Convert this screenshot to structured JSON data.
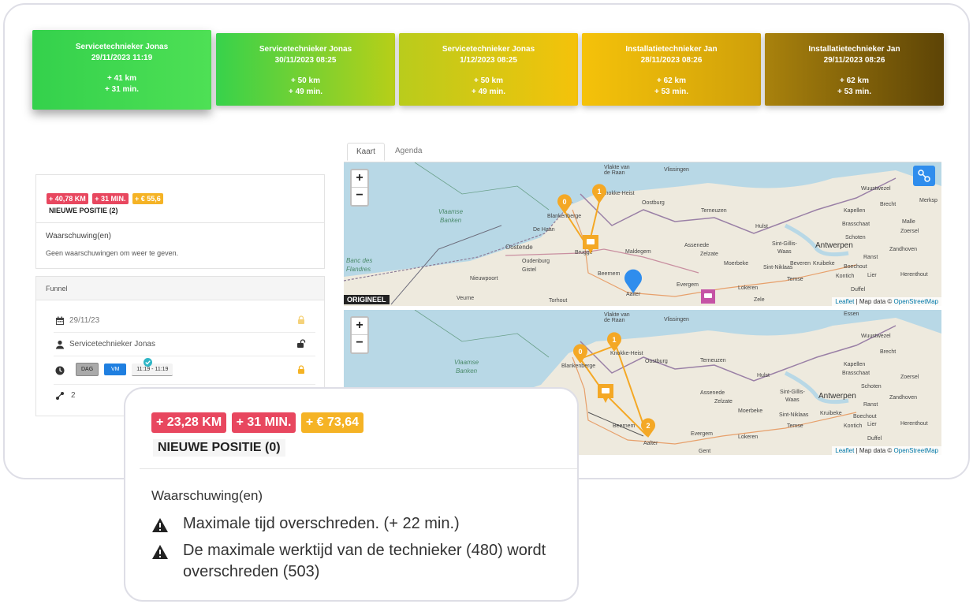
{
  "cards": [
    {
      "title": "Servicetechnieker Jonas",
      "datetime": "29/11/2023 11:19",
      "km": "+ 41 km",
      "min": "+ 31 min."
    },
    {
      "title": "Servicetechnieker Jonas",
      "datetime": "30/11/2023 08:25",
      "km": "+ 50 km",
      "min": "+ 49 min."
    },
    {
      "title": "Servicetechnieker Jonas",
      "datetime": "1/12/2023 08:25",
      "km": "+ 50 km",
      "min": "+ 49 min."
    },
    {
      "title": "Installatietechnieker Jan",
      "datetime": "28/11/2023 08:26",
      "km": "+ 62 km",
      "min": "+ 53 min."
    },
    {
      "title": "Installatietechnieker Jan",
      "datetime": "29/11/2023 08:26",
      "km": "+ 62 km",
      "min": "+ 53 min."
    }
  ],
  "summary": {
    "badges": [
      "+ 40,78 KM",
      "+ 31 MIN.",
      "+ € 55,6"
    ],
    "position": "NIEUWE POSITIE (2)",
    "warnings_title": "Waarschuwing(en)",
    "no_warnings": "Geen waarschuwingen om weer te geven."
  },
  "funnel": {
    "title": "Funnel",
    "date": "29/11/23",
    "technician": "Servicetechnieker Jonas",
    "day_btn": "DAG",
    "vm_btn": "VM",
    "time_range": "11:19 - 11:19",
    "count": "2"
  },
  "tabs": [
    "Kaart",
    "Agenda"
  ],
  "map": {
    "zoom_in": "+",
    "zoom_out": "−",
    "original_label": "ORIGINEEL",
    "attribution_leaflet": "Leaflet",
    "attribution_text": " | Map data © ",
    "attribution_osm": "OpenStreetMap",
    "markers_top": [
      "0",
      "1"
    ],
    "markers_bottom": [
      "0",
      "1",
      "2"
    ],
    "places": {
      "vlissingen": "Vlissingen",
      "oostburg": "Oostburg",
      "terneuzen": "Terneuzen",
      "hulst": "Hulst",
      "wuustwezel": "Wuustwezel",
      "kapellen": "Kapellen",
      "brecht": "Brecht",
      "merksplas": "Merksp",
      "malle": "Malle",
      "brasschaat": "Brasschaat",
      "zoersel": "Zoersel",
      "schoten": "Schoten",
      "antwerpen": "Antwerpen",
      "zandhoven": "Zandhoven",
      "sintgillis": "Sint-Gillis-",
      "waas": "Waas",
      "ranst": "Ranst",
      "assenede": "Assenede",
      "zelzate": "Zelzate",
      "moerbeke": "Moerbeke",
      "beveren": "Beveren",
      "kruibeke": "Kruibeke",
      "boechout": "Boechout",
      "stniklaas": "Sint-Niklaas",
      "temse": "Temse",
      "kontich": "Kontich",
      "lier": "Lier",
      "herenthout": "Herenthout",
      "duffel": "Duffel",
      "lokeren": "Lokeren",
      "zele": "Zele",
      "evergem": "Evergem",
      "maldegem": "Maldegem",
      "oostende": "Oostende",
      "oudenburg": "Oudenburg",
      "gistel": "Gistel",
      "nieuwpoort": "Nieuwpoort",
      "dehaan": "De Haan",
      "blankenberge": "Blankenberge",
      "knokkeheist": "Knokke-Heist",
      "brugge": "Brugge",
      "beernem": "Beernem",
      "aalter": "Aalter",
      "torhout": "Torhout",
      "veurne": "Veurne",
      "vlaamse1": "Vlaamse",
      "vlaamse2": "Banken",
      "banc1": "Banc des",
      "banc2": "Flandres",
      "vlakte1": "Vlakte van",
      "vlakte2": "de Raan",
      "essen": "Essen",
      "gent": "Gent"
    }
  },
  "popup": {
    "badges": [
      "+ 23,28 KM",
      "+ 31 MIN.",
      "+ € 73,64"
    ],
    "position": "NIEUWE POSITIE (0)",
    "warnings_title": "Waarschuwing(en)",
    "warnings": [
      "Maximale tijd overschreden. (+ 22 min.)",
      "De maximale werktijd van de technieker (480) wordt overschreden (503)"
    ]
  },
  "colors": {
    "card_gradients": [
      [
        "#34d14c",
        "#4ee055"
      ],
      [
        "#37d24b",
        "#b7cf18"
      ],
      [
        "#b9cc1c",
        "#f5c20a"
      ],
      [
        "#f5c20a",
        "#cfa00a"
      ],
      [
        "#a9820d",
        "#5d4406"
      ]
    ],
    "badge_red": "#e8475f",
    "badge_orange": "#f5b325",
    "map_sea": "#b8d8e6",
    "map_land": "#eeeade",
    "marker_orange": "#f4a825",
    "marker_blue": "#2f8ded"
  }
}
